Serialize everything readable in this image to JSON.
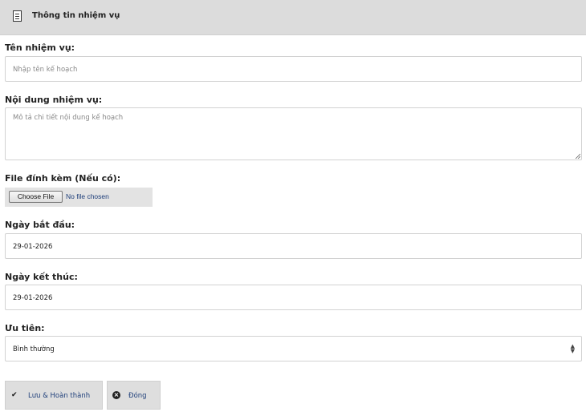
{
  "header": {
    "title": "Thông tin nhiệm vụ",
    "icon": "document-icon"
  },
  "form": {
    "task_name": {
      "label": "Tên nhiệm vụ:",
      "placeholder": "Nhập tên kế hoạch",
      "value": ""
    },
    "task_content": {
      "label": "Nội dung nhiệm vụ:",
      "placeholder": "Mô tả chi tiết nội dung kế hoạch",
      "value": ""
    },
    "attachment": {
      "label": "File đính kèm (Nếu có):",
      "button_label": "Choose File",
      "status": "No file chosen"
    },
    "start_date": {
      "label": "Ngày bắt đầu:",
      "value": "29-01-2026"
    },
    "end_date": {
      "label": "Ngày kết thúc:",
      "value": "29-01-2026"
    },
    "priority": {
      "label": "Ưu tiên:",
      "value": "Bình thường"
    }
  },
  "actions": {
    "save_label": "Lưu & Hoàn thành",
    "close_label": "Đóng"
  }
}
